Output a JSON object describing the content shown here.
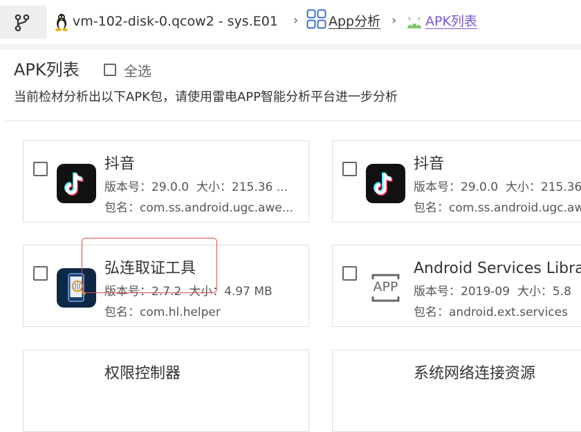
{
  "breadcrumb": {
    "device": "vm-102-disk-0.qcow2 - sys.E01",
    "sep": "›",
    "section": "App分析",
    "current": "APK列表"
  },
  "header": {
    "title": "APK列表",
    "select_all": "全选",
    "subtitle": "当前检材分析出以下APK包，请使用雷电APP智能分析平台进一步分析"
  },
  "apps": [
    {
      "name": "抖音",
      "version_label": "版本号：29.0.0",
      "size_label": "大小：215.36 ...",
      "package_label": "包名：com.ss.android.ugc.awe...",
      "icon": "tiktok-icon"
    },
    {
      "name": "抖音",
      "version_label": "版本号：29.0.0",
      "size_label": "大小：215.36",
      "package_label": "包名：com.ss.android.ugc.awe",
      "icon": "tiktok-icon"
    },
    {
      "name": "弘连取证工具",
      "version_label": "版本号：2.7.2",
      "size_label": "大小：4.97 MB",
      "package_label": "包名：com.hl.helper",
      "icon": "hl-helper-icon"
    },
    {
      "name": "Android Services Library",
      "version_label": "版本号：2019-09",
      "size_label": "大小：5.8",
      "package_label": "包名：android.ext.services",
      "icon": "generic-app-icon"
    },
    {
      "name": "权限控制器",
      "version_label": "",
      "size_label": "",
      "package_label": "",
      "icon": ""
    },
    {
      "name": "系统网络连接资源",
      "version_label": "",
      "size_label": "",
      "package_label": "",
      "icon": ""
    }
  ],
  "generic_icon_text": "APP",
  "colors": {
    "accent": "#7b55d6",
    "highlight": "#e04a4a",
    "tiktok_cyan": "#25f4ee",
    "tiktok_red": "#fe2c55"
  }
}
